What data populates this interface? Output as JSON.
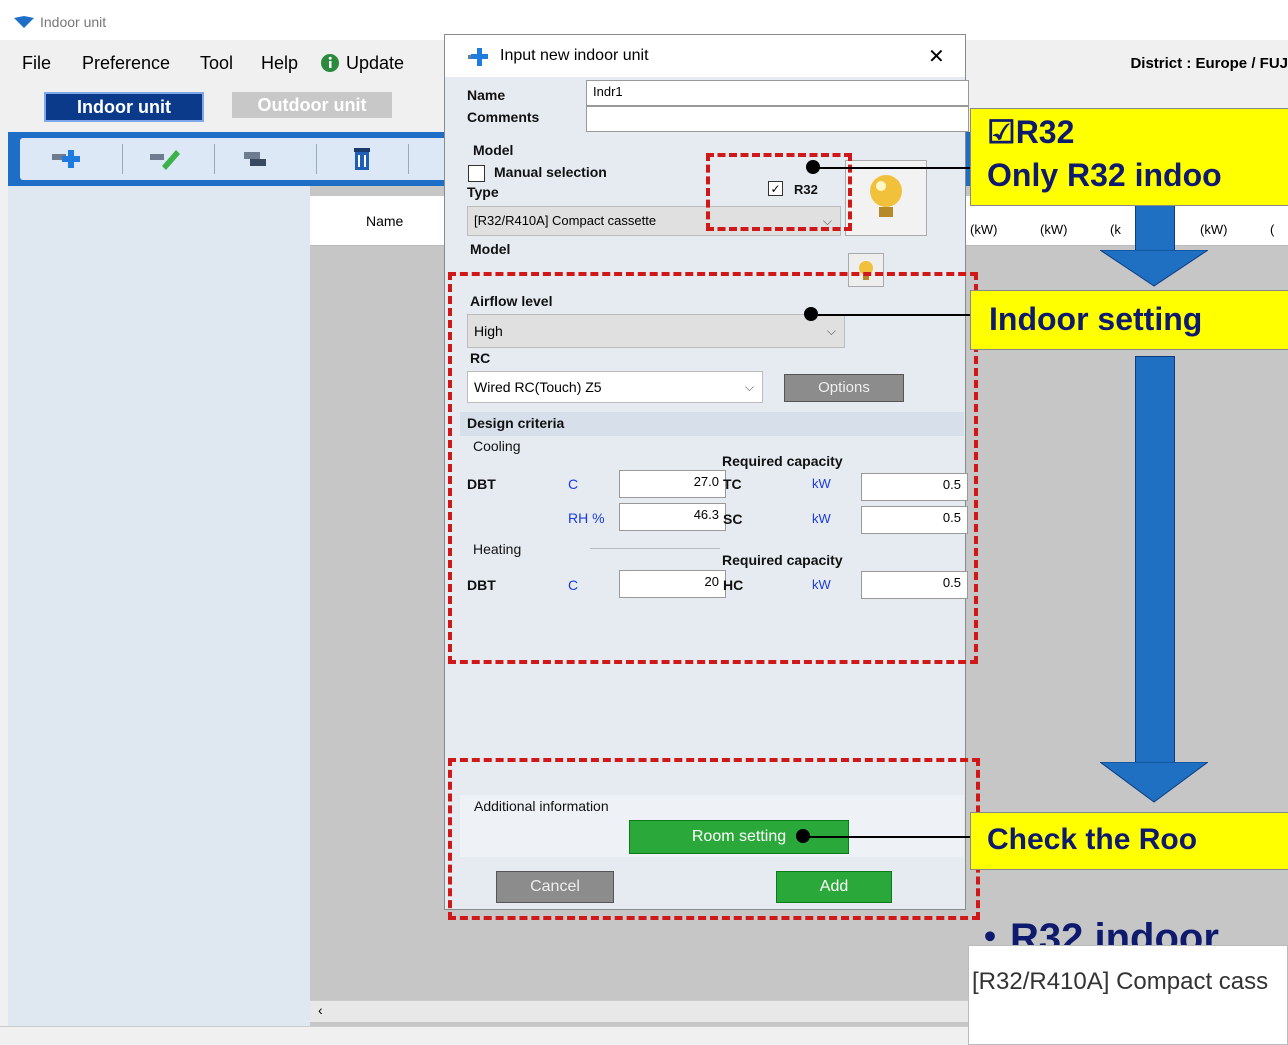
{
  "window": {
    "title": "Indoor unit",
    "district": "District : Europe / FUJ"
  },
  "menu": {
    "file": "File",
    "preference": "Preference",
    "tool": "Tool",
    "help": "Help",
    "update": "Update"
  },
  "tabs": {
    "indoor": "Indoor unit",
    "outdoor": "Outdoor unit"
  },
  "grid": {
    "name_col": "Name",
    "units": [
      "(kW)",
      "(kW)",
      "(k",
      "(kW)",
      "("
    ]
  },
  "dialog": {
    "title": "Input new indoor unit",
    "name_label": "Name",
    "name_value": "Indr1",
    "comments_label": "Comments",
    "comments_value": "",
    "model_label": "Model",
    "manual_selection": "Manual selection",
    "type_label": "Type",
    "r32_label": "R32",
    "type_value": "[R32/R410A] Compact cassette",
    "model_label2": "Model",
    "airflow_label": "Airflow level",
    "airflow_value": "High",
    "rc_label": "RC",
    "rc_value": "Wired RC(Touch) Z5",
    "options_button": "Options",
    "design_criteria": "Design criteria",
    "cooling": "Cooling",
    "heating": "Heating",
    "required_capacity": "Required capacity",
    "dbt": "DBT",
    "c_unit": "C",
    "rh_unit": "RH %",
    "kw_unit": "kW",
    "tc": "TC",
    "sc": "SC",
    "hc": "HC",
    "cool_dbt": "27.0",
    "cool_rh": "46.3",
    "tc_value": "0.5",
    "sc_value": "0.5",
    "heat_dbt": "20",
    "hc_value": "0.5",
    "additional_info": "Additional information",
    "room_setting": "Room setting",
    "cancel": "Cancel",
    "add": "Add"
  },
  "callouts": {
    "r32_title": "☑R32",
    "r32_desc": "Only R32 indoo",
    "indoor_setting": "Indoor setting",
    "check_room": "Check the Roo"
  },
  "bottom": {
    "title": "・R32 indoor",
    "snippet": "[R32/R410A] Compact cass"
  },
  "colors": {
    "accent": "#1e6ec8",
    "callout": "#ffff00",
    "highlight_border": "#d01818",
    "button_green": "#2aa83a"
  }
}
